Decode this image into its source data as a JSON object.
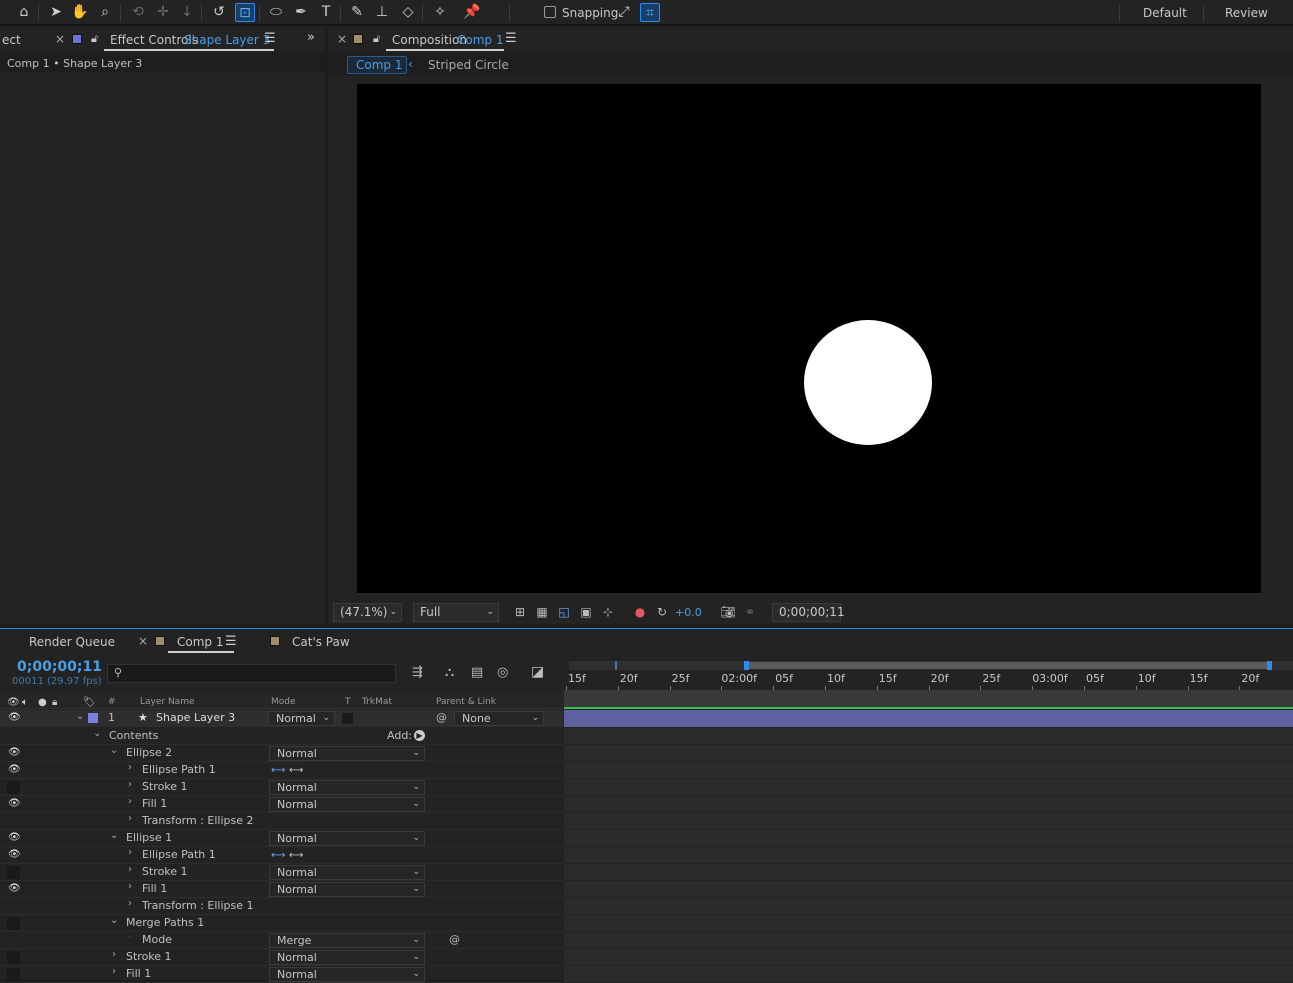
{
  "toolbar": {
    "snapping_label": "Snapping",
    "workspaces": [
      "Default",
      "Review"
    ],
    "icons": [
      "home-icon",
      "selection-arrow-icon",
      "hand-icon",
      "zoom-icon",
      "orbit-icon",
      "pan-icon",
      "dolly-icon",
      "rotation-icon",
      "pan-behind-icon",
      "ellipse-icon",
      "pen-icon",
      "type-icon",
      "brush-icon",
      "clone-stamp-icon",
      "eraser-icon",
      "roto-brush-icon",
      "puppet-pin-icon"
    ]
  },
  "left_panel": {
    "tab_cut": "ect",
    "tab_label": "Effect Controls",
    "tab_layer": "Shape Layer 3",
    "breadcrumb": "Comp 1 • Shape Layer 3"
  },
  "comp_panel": {
    "tab_label": "Composition",
    "tab_comp": "Comp 1",
    "crumb_active": "Comp 1",
    "crumb_next": "Striped Circle",
    "zoom": "(47.1%)",
    "resolution": "Full",
    "exposure": "+0.0",
    "timecode": "0;00;00;11",
    "colors": {
      "accent": "#4a9fe8",
      "canvas": "#000000",
      "circle": "#ffffff"
    }
  },
  "timeline": {
    "tabs": [
      "Render Queue",
      "Comp 1",
      "Cat's Paw"
    ],
    "timecode": "0;00;00;11",
    "frame_info": "00011 (29.97 fps)",
    "search_placeholder": "",
    "columns": {
      "num": "#",
      "layer_name": "Layer Name",
      "mode": "Mode",
      "t": "T",
      "trkmat": "TrkMat",
      "parent": "Parent & Link"
    },
    "layer": {
      "index": "1",
      "name": "Shape Layer 3",
      "mode": "Normal",
      "parent": "None",
      "color": "#7a7fe0"
    },
    "contents_label": "Contents",
    "add_label": "Add:",
    "rows": [
      {
        "name": "Ellipse 2",
        "mode": "Normal"
      },
      {
        "name": "Ellipse Path 1",
        "mode": ""
      },
      {
        "name": "Stroke 1",
        "mode": "Normal"
      },
      {
        "name": "Fill 1",
        "mode": "Normal"
      },
      {
        "name": "Transform : Ellipse 2",
        "mode": ""
      },
      {
        "name": "Ellipse 1",
        "mode": "Normal"
      },
      {
        "name": "Ellipse Path 1",
        "mode": ""
      },
      {
        "name": "Stroke 1",
        "mode": "Normal"
      },
      {
        "name": "Fill 1",
        "mode": "Normal"
      },
      {
        "name": "Transform : Ellipse 1",
        "mode": ""
      },
      {
        "name": "Merge Paths 1",
        "mode": ""
      },
      {
        "name": "Mode",
        "mode": "Merge"
      },
      {
        "name": "Stroke 1",
        "mode": "Normal"
      },
      {
        "name": "Fill 1",
        "mode": "Normal"
      }
    ],
    "ruler": [
      "15f",
      "20f",
      "25f",
      "02:00f",
      "05f",
      "10f",
      "15f",
      "20f",
      "25f",
      "03:00f",
      "05f",
      "10f",
      "15f",
      "20f"
    ]
  }
}
